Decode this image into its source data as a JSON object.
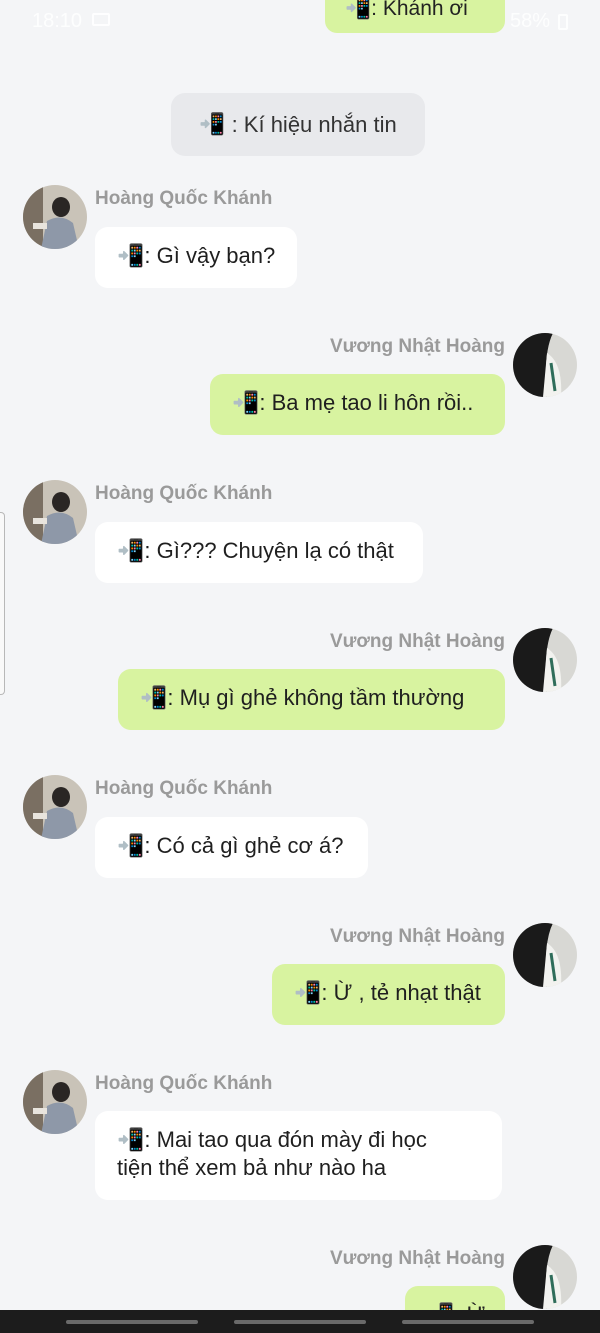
{
  "status_bar": {
    "time": "18:10",
    "battery": "58%"
  },
  "top_partial": {
    "text": ": Khánh ơi"
  },
  "legend": {
    "text": ": Kí hiệu nhắn tin"
  },
  "phone_icon": "📲",
  "messages": [
    {
      "sender": "Hoàng Quốc Khánh",
      "side": "in",
      "lines": [
        "📲: Gì vậy bạn?"
      ]
    },
    {
      "sender": "Vương Nhật Hoàng",
      "side": "out",
      "lines": [
        "📲: Ba mẹ tao li hôn rồi.."
      ]
    },
    {
      "sender": "Hoàng Quốc Khánh",
      "side": "in",
      "lines": [
        "📲: Gì??? Chuyện lạ có thật"
      ]
    },
    {
      "sender": "Vương Nhật Hoàng",
      "side": "out",
      "lines": [
        "📲: Mụ gì ghẻ không tầm thường"
      ]
    },
    {
      "sender": "Hoàng Quốc Khánh",
      "side": "in",
      "lines": [
        "📲: Có cả gì ghẻ cơ á?"
      ]
    },
    {
      "sender": "Vương Nhật Hoàng",
      "side": "out",
      "lines": [
        "📲: Ừ , tẻ nhạt thật"
      ]
    },
    {
      "sender": "Hoàng Quốc Khánh",
      "side": "in",
      "lines": [
        "📲: Mai tao qua đón mày đi học",
        "tiện thể xem bả như nào ha"
      ]
    },
    {
      "sender": "Vương Nhật Hoàng",
      "side": "out",
      "lines": [
        "📲: Ừ"
      ]
    }
  ],
  "colors": {
    "incoming_bubble": "#ffffff",
    "outgoing_bubble": "#d8f3a0",
    "background": "#f4f5f7",
    "sender_name": "#9a9a9a"
  }
}
